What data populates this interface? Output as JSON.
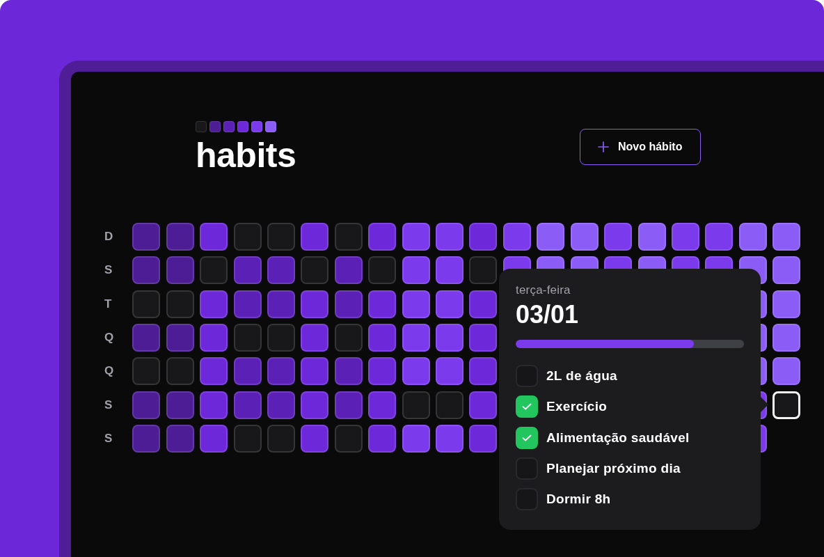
{
  "legend": [
    {
      "color": "#18181b"
    },
    {
      "color": "#4c1d95"
    },
    {
      "color": "#5b21b6"
    },
    {
      "color": "#6d28d9"
    },
    {
      "color": "#7c3aed"
    },
    {
      "color": "#8b5cf6"
    }
  ],
  "title": "habits",
  "new_habit_button": {
    "label": "Novo hábito"
  },
  "grid": {
    "rows": [
      {
        "day": "D",
        "cells": [
          {
            "color": "#4c1d95",
            "selected": false
          },
          {
            "color": "#4c1d95",
            "selected": false
          },
          {
            "color": "#6d28d9",
            "selected": false
          },
          {
            "color": "#18181b",
            "selected": false
          },
          {
            "color": "#18181b",
            "selected": false
          },
          {
            "color": "#6d28d9",
            "selected": false
          },
          {
            "color": "#18181b",
            "selected": false
          },
          {
            "color": "#6d28d9",
            "selected": false
          },
          {
            "color": "#7c3aed",
            "selected": false
          },
          {
            "color": "#7c3aed",
            "selected": false
          },
          {
            "color": "#6d28d9",
            "selected": false
          },
          {
            "color": "#7c3aed",
            "selected": false
          },
          {
            "color": "#8b5cf6",
            "selected": false
          },
          {
            "color": "#8b5cf6",
            "selected": false
          },
          {
            "color": "#7c3aed",
            "selected": false
          },
          {
            "color": "#8b5cf6",
            "selected": false
          },
          {
            "color": "#7c3aed",
            "selected": false
          },
          {
            "color": "#7c3aed",
            "selected": false
          },
          {
            "color": "#8b5cf6",
            "selected": false
          },
          {
            "color": "#8b5cf6",
            "selected": false
          }
        ]
      },
      {
        "day": "S",
        "cells": [
          {
            "color": "#4c1d95",
            "selected": false
          },
          {
            "color": "#4c1d95",
            "selected": false
          },
          {
            "color": "#18181b",
            "selected": false
          },
          {
            "color": "#5b21b6",
            "selected": false
          },
          {
            "color": "#5b21b6",
            "selected": false
          },
          {
            "color": "#18181b",
            "selected": false
          },
          {
            "color": "#5b21b6",
            "selected": false
          },
          {
            "color": "#18181b",
            "selected": false
          },
          {
            "color": "#7c3aed",
            "selected": false
          },
          {
            "color": "#7c3aed",
            "selected": false
          },
          {
            "color": "#18181b",
            "selected": false
          },
          {
            "color": "#7c3aed",
            "selected": false
          },
          {
            "color": "#8b5cf6",
            "selected": false
          },
          {
            "color": "#8b5cf6",
            "selected": false
          },
          {
            "color": "#7c3aed",
            "selected": false
          },
          {
            "color": "#8b5cf6",
            "selected": false
          },
          {
            "color": "#7c3aed",
            "selected": false
          },
          {
            "color": "#7c3aed",
            "selected": false
          },
          {
            "color": "#8b5cf6",
            "selected": false
          },
          {
            "color": "#8b5cf6",
            "selected": false
          }
        ]
      },
      {
        "day": "T",
        "cells": [
          {
            "color": "#18181b",
            "selected": false
          },
          {
            "color": "#18181b",
            "selected": false
          },
          {
            "color": "#6d28d9",
            "selected": false
          },
          {
            "color": "#5b21b6",
            "selected": false
          },
          {
            "color": "#5b21b6",
            "selected": false
          },
          {
            "color": "#6d28d9",
            "selected": false
          },
          {
            "color": "#5b21b6",
            "selected": false
          },
          {
            "color": "#6d28d9",
            "selected": false
          },
          {
            "color": "#7c3aed",
            "selected": false
          },
          {
            "color": "#7c3aed",
            "selected": false
          },
          {
            "color": "#6d28d9",
            "selected": false
          },
          null,
          null,
          null,
          null,
          null,
          null,
          null,
          {
            "color": "#8b5cf6",
            "selected": false
          },
          {
            "color": "#8b5cf6",
            "selected": false
          }
        ]
      },
      {
        "day": "Q",
        "cells": [
          {
            "color": "#4c1d95",
            "selected": false
          },
          {
            "color": "#4c1d95",
            "selected": false
          },
          {
            "color": "#6d28d9",
            "selected": false
          },
          {
            "color": "#18181b",
            "selected": false
          },
          {
            "color": "#18181b",
            "selected": false
          },
          {
            "color": "#6d28d9",
            "selected": false
          },
          {
            "color": "#18181b",
            "selected": false
          },
          {
            "color": "#6d28d9",
            "selected": false
          },
          {
            "color": "#7c3aed",
            "selected": false
          },
          {
            "color": "#7c3aed",
            "selected": false
          },
          {
            "color": "#6d28d9",
            "selected": false
          },
          null,
          null,
          null,
          null,
          null,
          null,
          null,
          {
            "color": "#8b5cf6",
            "selected": false
          },
          {
            "color": "#8b5cf6",
            "selected": false
          }
        ]
      },
      {
        "day": "Q",
        "cells": [
          {
            "color": "#18181b",
            "selected": false
          },
          {
            "color": "#18181b",
            "selected": false
          },
          {
            "color": "#6d28d9",
            "selected": false
          },
          {
            "color": "#5b21b6",
            "selected": false
          },
          {
            "color": "#5b21b6",
            "selected": false
          },
          {
            "color": "#6d28d9",
            "selected": false
          },
          {
            "color": "#5b21b6",
            "selected": false
          },
          {
            "color": "#6d28d9",
            "selected": false
          },
          {
            "color": "#7c3aed",
            "selected": false
          },
          {
            "color": "#7c3aed",
            "selected": false
          },
          {
            "color": "#6d28d9",
            "selected": false
          },
          null,
          null,
          null,
          null,
          null,
          null,
          null,
          {
            "color": "#8b5cf6",
            "selected": false
          },
          {
            "color": "#8b5cf6",
            "selected": false
          }
        ]
      },
      {
        "day": "S",
        "cells": [
          {
            "color": "#4c1d95",
            "selected": false
          },
          {
            "color": "#4c1d95",
            "selected": false
          },
          {
            "color": "#6d28d9",
            "selected": false
          },
          {
            "color": "#5b21b6",
            "selected": false
          },
          {
            "color": "#5b21b6",
            "selected": false
          },
          {
            "color": "#6d28d9",
            "selected": false
          },
          {
            "color": "#5b21b6",
            "selected": false
          },
          {
            "color": "#6d28d9",
            "selected": false
          },
          {
            "color": "#18181b",
            "selected": false
          },
          {
            "color": "#18181b",
            "selected": false
          },
          {
            "color": "#6d28d9",
            "selected": false
          },
          null,
          null,
          null,
          null,
          null,
          null,
          null,
          {
            "color": "#7c3aed",
            "selected": false
          },
          {
            "color": "#18181b",
            "selected": true
          }
        ]
      },
      {
        "day": "S",
        "cells": [
          {
            "color": "#4c1d95",
            "selected": false
          },
          {
            "color": "#4c1d95",
            "selected": false
          },
          {
            "color": "#6d28d9",
            "selected": false
          },
          {
            "color": "#18181b",
            "selected": false
          },
          {
            "color": "#18181b",
            "selected": false
          },
          {
            "color": "#6d28d9",
            "selected": false
          },
          {
            "color": "#18181b",
            "selected": false
          },
          {
            "color": "#6d28d9",
            "selected": false
          },
          {
            "color": "#7c3aed",
            "selected": false
          },
          {
            "color": "#7c3aed",
            "selected": false
          },
          {
            "color": "#6d28d9",
            "selected": false
          },
          null,
          null,
          null,
          null,
          null,
          null,
          null,
          {
            "color": "#7c3aed",
            "selected": false
          }
        ]
      }
    ]
  },
  "popover": {
    "weekday": "terça-feira",
    "date": "03/01",
    "progress": {
      "level": 0.78
    },
    "habits": [
      {
        "label": "2L de água",
        "checked": false
      },
      {
        "label": "Exercício",
        "checked": true
      },
      {
        "label": "Alimentação saudável",
        "checked": true
      },
      {
        "label": "Planejar próximo dia",
        "checked": false
      },
      {
        "label": "Dormir 8h",
        "checked": false
      }
    ]
  }
}
